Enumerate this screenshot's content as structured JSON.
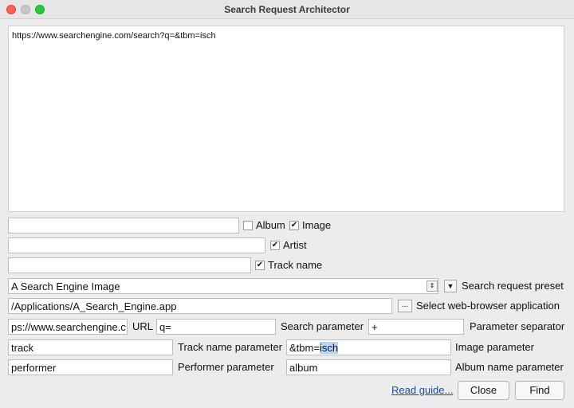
{
  "window": {
    "title": "Search Request Architector"
  },
  "output": {
    "text": "https://www.searchengine.com/search?q=&tbm=isch"
  },
  "row1": {
    "value": "",
    "album_label": "Album",
    "album_checked": false,
    "image_label": "Image",
    "image_checked": true
  },
  "row2": {
    "value": "",
    "artist_label": "Artist",
    "artist_checked": true
  },
  "row3": {
    "value": "",
    "track_label": "Track name",
    "track_checked": true
  },
  "preset": {
    "selected": "A Search Engine Image",
    "label": "Search request preset"
  },
  "browser": {
    "value": "/Applications/A_Search_Engine.app",
    "button_label": "...",
    "label": "Select web-browser application"
  },
  "url_row": {
    "url_value": "ps://www.searchengine.c",
    "url_label": "URL",
    "search_param_value": "q=",
    "search_param_label": "Search parameter",
    "separator_value": "+",
    "separator_label": "Parameter separator"
  },
  "track_row": {
    "track_param_value": "track",
    "track_param_label": "Track name parameter",
    "image_param_prefix": "&tbm=",
    "image_param_selected": "isch",
    "image_param_label": "Image parameter"
  },
  "performer_row": {
    "performer_param_value": "performer",
    "performer_param_label": "Performer parameter",
    "album_param_value": "album",
    "album_param_label": "Album name parameter"
  },
  "footer": {
    "read_guide": "Read guide...",
    "close": "Close",
    "find": "Find"
  },
  "glyphs": {
    "check": "✔",
    "arrow_down": "▼"
  },
  "colors": {
    "selection": "#b3d7ff",
    "link": "#1a4fa0"
  }
}
